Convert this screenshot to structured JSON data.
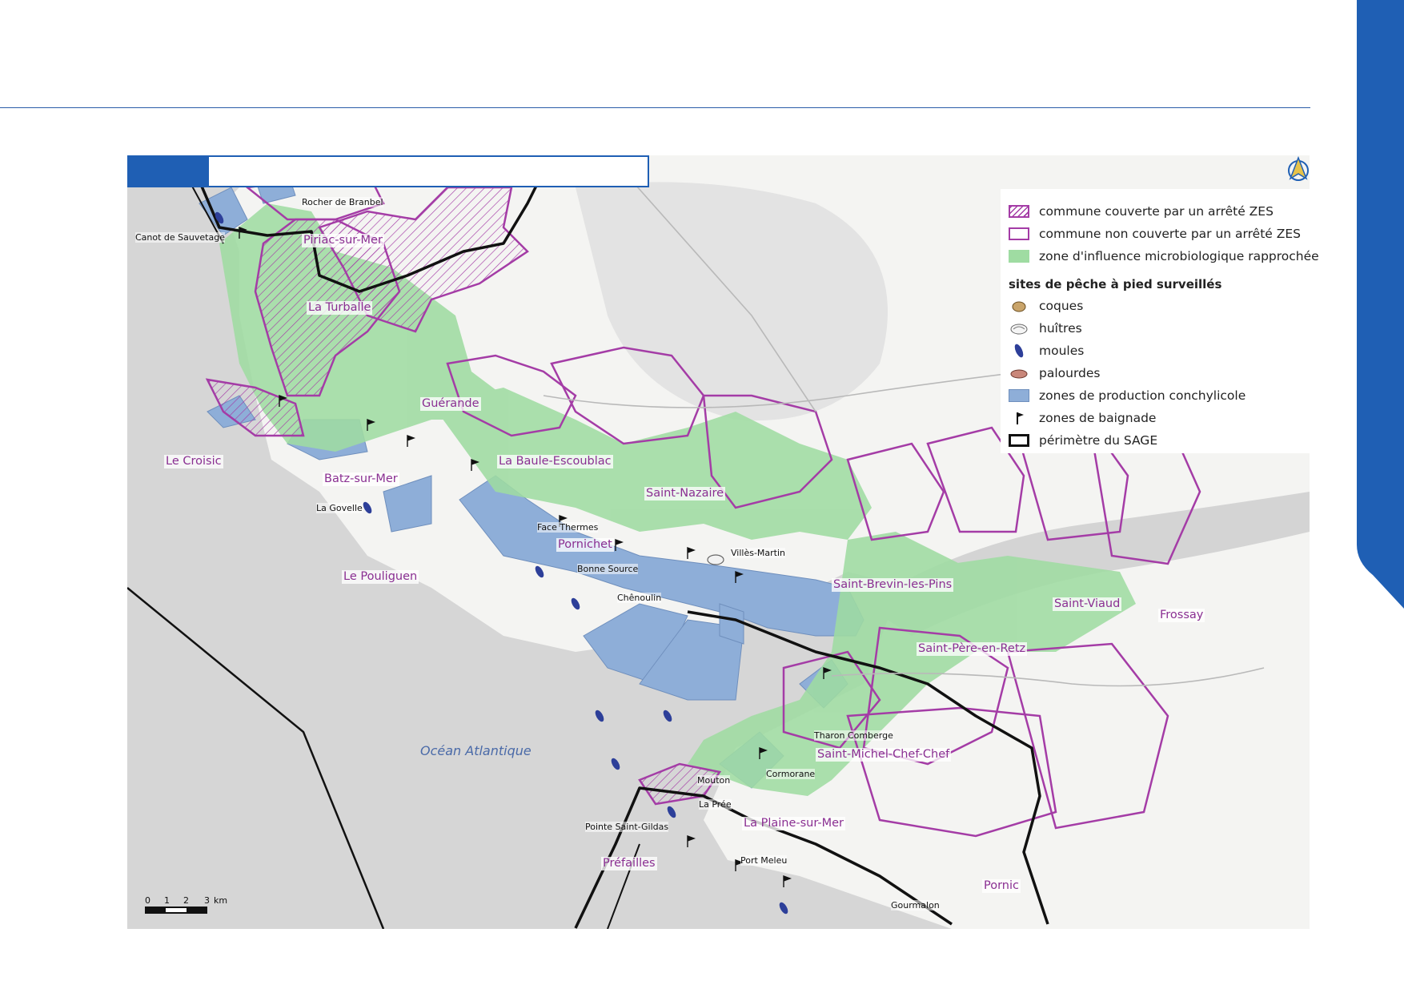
{
  "legend": {
    "rows": [
      {
        "label": "commune couverte par un arrêté ZES"
      },
      {
        "label": "commune non couverte par un arrêté ZES"
      },
      {
        "label": "zone d'influence microbiologique rapprochée"
      }
    ],
    "sites_title": "sites de pêche à pied surveillés",
    "sites": [
      {
        "label": "coques",
        "icon": "cockle-icon"
      },
      {
        "label": "huîtres",
        "icon": "oyster-icon"
      },
      {
        "label": "moules",
        "icon": "mussel-icon"
      },
      {
        "label": "palourdes",
        "icon": "clam-icon"
      }
    ],
    "more": [
      {
        "label": "zones de production conchylicole"
      },
      {
        "label": "zones de baignade"
      },
      {
        "label": "périmètre du SAGE"
      }
    ]
  },
  "communes": [
    "Piriac-sur-Mer",
    "La Turballe",
    "Guérande",
    "Le Croisic",
    "La Baule-Escoublac",
    "Batz-sur-Mer",
    "Saint-Nazaire",
    "Pornichet",
    "Le Pouliguen",
    "Saint-Brevin-les-Pins",
    "Saint-Viaud",
    "Frossay",
    "Saint-Père-en-Retz",
    "Saint-Michel-Chef-Chef",
    "La Plaine-sur-Mer",
    "Préfailles",
    "Pornic"
  ],
  "sites": [
    "Rocher de Branbel",
    "Canot de Sauvetage",
    "La Govelle",
    "Face Thermes",
    "Bonne Source",
    "Chênoulin",
    "Villès-Martin",
    "Tharon Comberge",
    "Cormorane",
    "Mouton",
    "La Prée",
    "Pointe Saint-Gildas",
    "Port Meleu",
    "Gourmalon"
  ],
  "ocean": "Océan Atlantique",
  "scale": {
    "ticks": [
      "0",
      "1",
      "2",
      "3"
    ],
    "unit": "km"
  },
  "colors": {
    "brand_blue": "#1f5fb4",
    "zes_purple": "#a43ca6",
    "influence_green": "#9fdca2",
    "shellfish_blue": "#8eaed8",
    "sage_black": "#111111",
    "sea_gray": "#d6d6d6"
  }
}
